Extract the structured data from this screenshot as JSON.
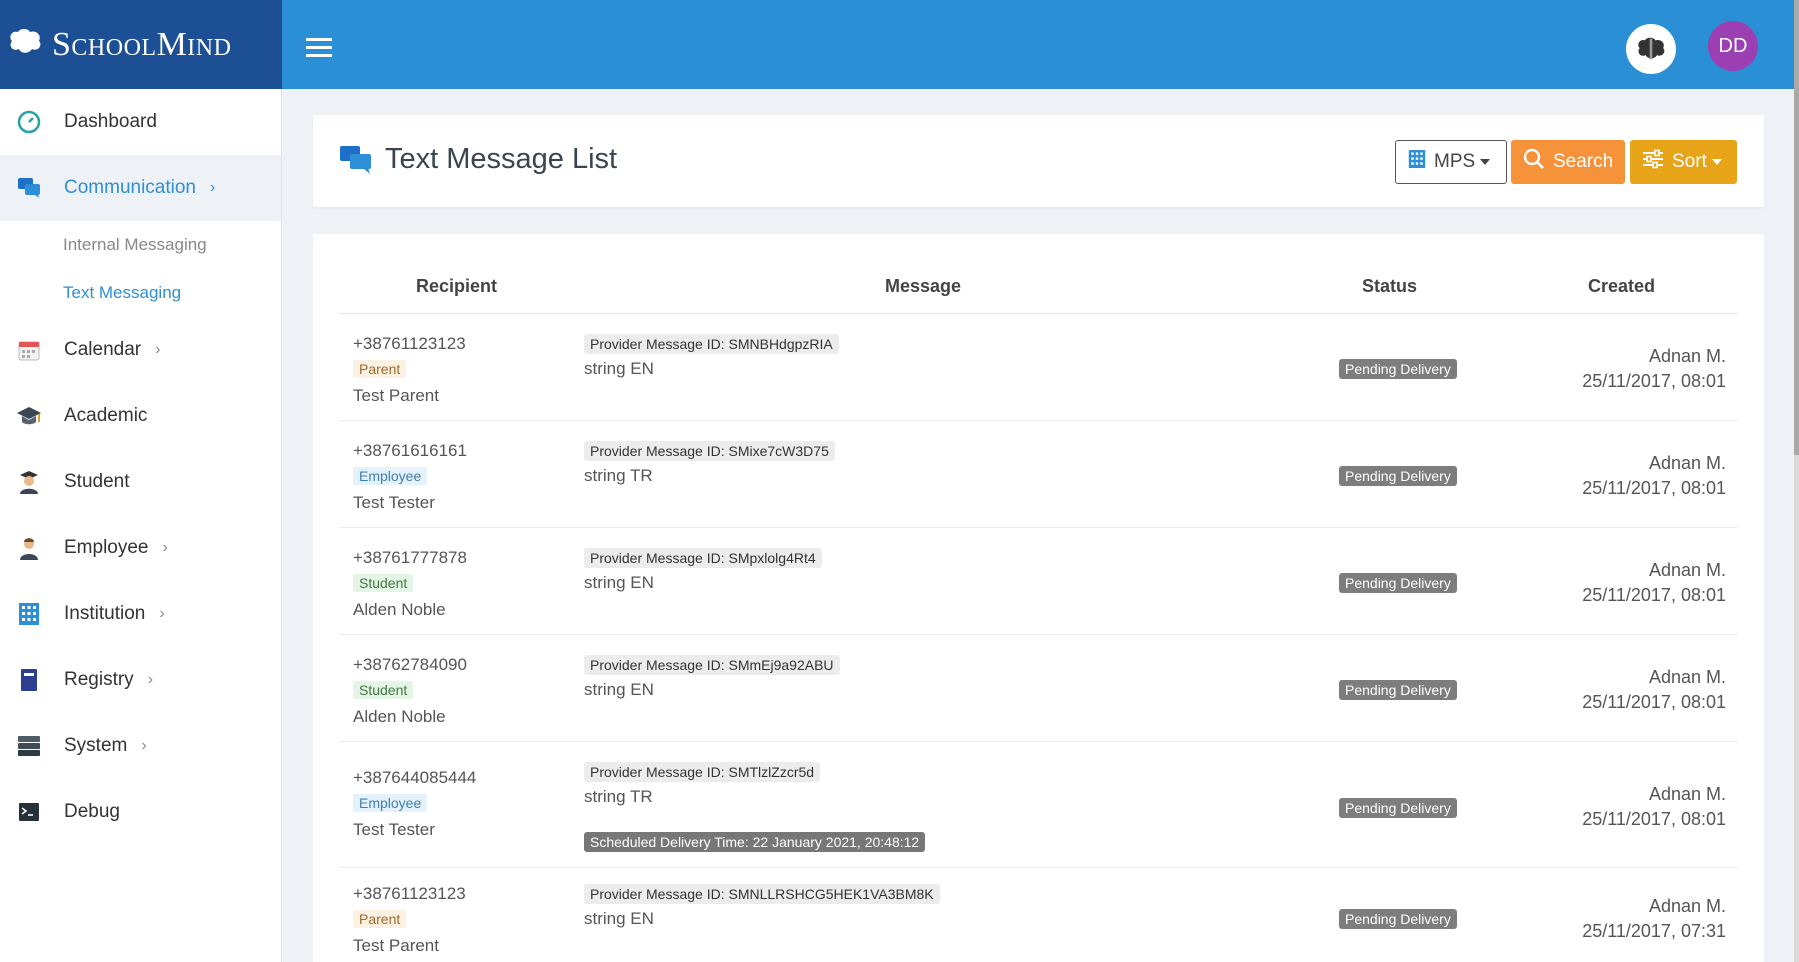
{
  "brand": {
    "name": "SchoolMind"
  },
  "header": {
    "user_initials": "DD"
  },
  "sidebar": {
    "items": [
      {
        "label": "Dashboard"
      },
      {
        "label": "Communication"
      },
      {
        "label": "Internal Messaging"
      },
      {
        "label": "Text Messaging"
      },
      {
        "label": "Calendar"
      },
      {
        "label": "Academic"
      },
      {
        "label": "Student"
      },
      {
        "label": "Employee"
      },
      {
        "label": "Institution"
      },
      {
        "label": "Registry"
      },
      {
        "label": "System"
      },
      {
        "label": "Debug"
      }
    ]
  },
  "page": {
    "title": "Text Message List",
    "mps_label": "MPS",
    "search_label": "Search",
    "sort_label": "Sort"
  },
  "table": {
    "headers": {
      "recipient": "Recipient",
      "message": "Message",
      "status": "Status",
      "created": "Created"
    },
    "rows": [
      {
        "phone": "+38761123123",
        "role": "Parent",
        "name": "Test Parent",
        "provider_id": "Provider Message ID: SMNBHdgpzRIA",
        "message": "string EN",
        "scheduled": "",
        "status": "Pending Delivery",
        "creator": "Adnan M.",
        "created": "25/11/2017, 08:01"
      },
      {
        "phone": "+38761616161",
        "role": "Employee",
        "name": "Test Tester",
        "provider_id": "Provider Message ID: SMixe7cW3D75",
        "message": "string TR",
        "scheduled": "",
        "status": "Pending Delivery",
        "creator": "Adnan M.",
        "created": "25/11/2017, 08:01"
      },
      {
        "phone": "+38761777878",
        "role": "Student",
        "name": "Alden Noble",
        "provider_id": "Provider Message ID: SMpxlolg4Rt4",
        "message": "string EN",
        "scheduled": "",
        "status": "Pending Delivery",
        "creator": "Adnan M.",
        "created": "25/11/2017, 08:01"
      },
      {
        "phone": "+38762784090",
        "role": "Student",
        "name": "Alden Noble",
        "provider_id": "Provider Message ID: SMmEj9a92ABU",
        "message": "string EN",
        "scheduled": "",
        "status": "Pending Delivery",
        "creator": "Adnan M.",
        "created": "25/11/2017, 08:01"
      },
      {
        "phone": "+387644085444",
        "role": "Employee",
        "name": "Test Tester",
        "provider_id": "Provider Message ID: SMTlzlZzcr5d",
        "message": "string TR",
        "scheduled": "Scheduled Delivery Time: 22 January 2021, 20:48:12",
        "status": "Pending Delivery",
        "creator": "Adnan M.",
        "created": "25/11/2017, 08:01"
      },
      {
        "phone": "+38761123123",
        "role": "Parent",
        "name": "Test Parent",
        "provider_id": "Provider Message ID: SMNLLRSHCG5HEK1VA3BM8K",
        "message": "string EN",
        "scheduled": "",
        "status": "Pending Delivery",
        "creator": "Adnan M.",
        "created": "25/11/2017, 07:31"
      }
    ]
  }
}
